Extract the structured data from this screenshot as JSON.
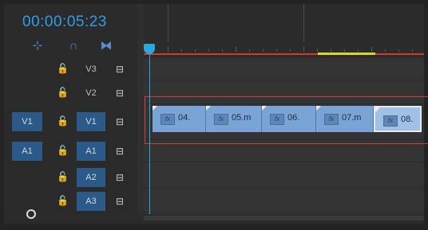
{
  "timecode": "00:00:05:23",
  "tools": [
    {
      "name": "snap-tool-icon",
      "glyph": "⊹"
    },
    {
      "name": "magnet-icon",
      "glyph": "∩"
    },
    {
      "name": "linked-selection-icon",
      "glyph": "⧓"
    }
  ],
  "tracks": [
    {
      "source": "",
      "target": "V3",
      "target_on": false
    },
    {
      "source": "",
      "target": "V2",
      "target_on": false
    },
    {
      "source": "V1",
      "target": "V1",
      "target_on": true
    },
    {
      "source": "A1",
      "target": "A1",
      "target_on": true
    },
    {
      "source": "",
      "target": "A2",
      "target_on": true
    },
    {
      "source": "",
      "target": "A3",
      "target_on": true
    }
  ],
  "lock_glyph": "🔓",
  "monitor_glyph": "⊟",
  "clips": [
    {
      "fx": "fx",
      "name": "04.",
      "selected": false
    },
    {
      "fx": "fx",
      "name": "05.m",
      "selected": false
    },
    {
      "fx": "fx",
      "name": "06.",
      "selected": false
    },
    {
      "fx": "fx",
      "name": "07.m",
      "selected": false
    },
    {
      "fx": "fx",
      "name": "08.",
      "selected": true
    }
  ],
  "colors": {
    "accent": "#29a7e0",
    "track_target": "#2b5a88",
    "clip": "#7aa3d6",
    "selection_outline": "#d83a3a",
    "in_out_bar": "#d43a2a",
    "work_area": "#d8d624"
  }
}
